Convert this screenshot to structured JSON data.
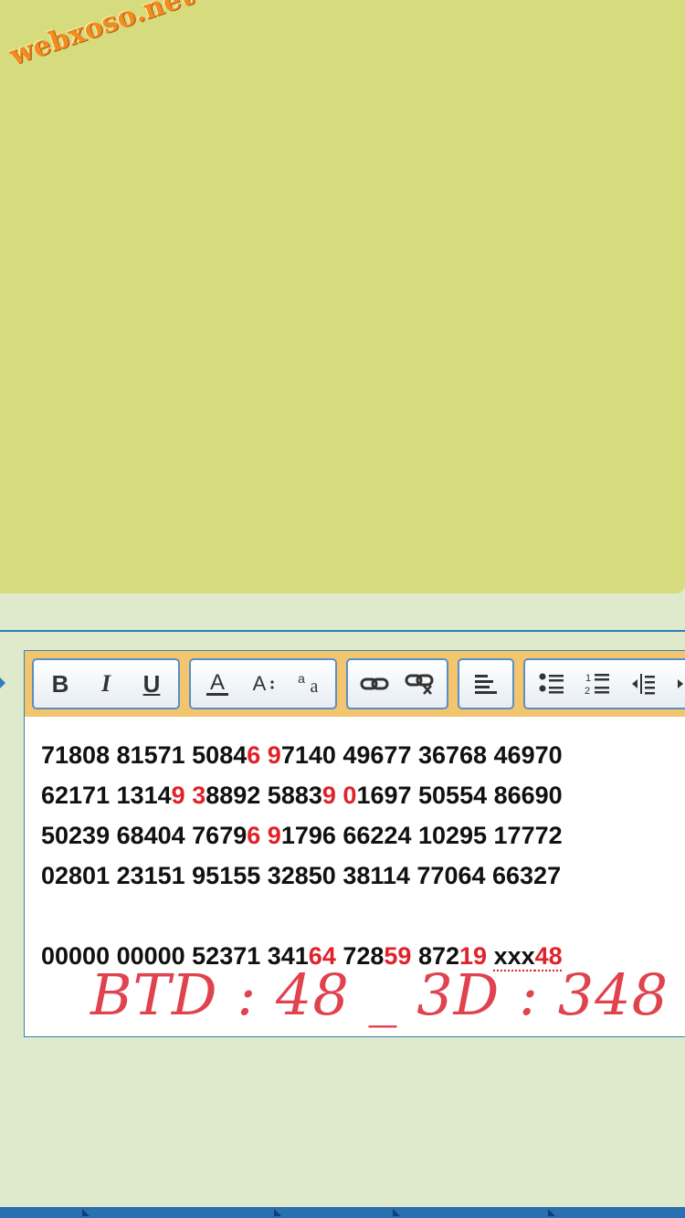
{
  "watermark": "webxoso.net",
  "toolbar": {
    "groups": [
      {
        "buttons": [
          {
            "label": "B",
            "icon": "bold-icon"
          },
          {
            "label": "I",
            "icon": "italic-icon"
          },
          {
            "label": "U",
            "icon": "underline-icon"
          }
        ]
      },
      {
        "buttons": [
          {
            "icon": "font-color-icon"
          },
          {
            "icon": "font-size-icon"
          },
          {
            "icon": "font-family-icon"
          }
        ]
      },
      {
        "buttons": [
          {
            "icon": "link-icon"
          },
          {
            "icon": "unlink-icon"
          }
        ]
      },
      {
        "buttons": [
          {
            "icon": "align-left-icon"
          }
        ]
      },
      {
        "buttons": [
          {
            "icon": "bullet-list-icon"
          },
          {
            "icon": "numbered-list-icon"
          },
          {
            "icon": "outdent-icon"
          },
          {
            "icon": "indent-icon"
          }
        ]
      }
    ]
  },
  "content": {
    "lines": [
      [
        {
          "t": "71808 81571 5084",
          "red": false
        },
        {
          "t": "6",
          "red": true
        },
        {
          "t": " ",
          "red": false
        },
        {
          "t": "9",
          "red": true
        },
        {
          "t": "7140 49677 36768 46970",
          "red": false
        }
      ],
      [
        {
          "t": "62171 1314",
          "red": false
        },
        {
          "t": "9",
          "red": true
        },
        {
          "t": " ",
          "red": false
        },
        {
          "t": "3",
          "red": true
        },
        {
          "t": "8892 5883",
          "red": false
        },
        {
          "t": "9",
          "red": true
        },
        {
          "t": " ",
          "red": false
        },
        {
          "t": "0",
          "red": true
        },
        {
          "t": "1697 50554 86690",
          "red": false
        }
      ],
      [
        {
          "t": "50239 68404 7679",
          "red": false
        },
        {
          "t": "6",
          "red": true
        },
        {
          "t": " ",
          "red": false
        },
        {
          "t": "9",
          "red": true
        },
        {
          "t": "1796 66224 10295 17772",
          "red": false
        }
      ],
      [
        {
          "t": "02801 23151 95155 32850 38114 77064 66327",
          "red": false
        }
      ],
      [],
      [
        {
          "t": "00000 00000 52371 341",
          "red": false
        },
        {
          "t": "64",
          "red": true
        },
        {
          "t": " 728",
          "red": false
        },
        {
          "t": "59",
          "red": true
        },
        {
          "t": " 872",
          "red": false
        },
        {
          "t": "19",
          "red": true
        },
        {
          "t": " ",
          "red": false
        },
        {
          "t": "xxx",
          "red": false,
          "spell": true
        },
        {
          "t": "48",
          "red": true,
          "spell": true
        }
      ]
    ],
    "handwritten_note": "BTD : 48 _ 3D : 348"
  },
  "colors": {
    "paint": "#d6dc7e",
    "background": "#dfeacc",
    "toolbar": "#f3c56e",
    "accent_red": "#e0222a",
    "note_red": "#e0424e",
    "border_blue": "#3a7fb4"
  }
}
